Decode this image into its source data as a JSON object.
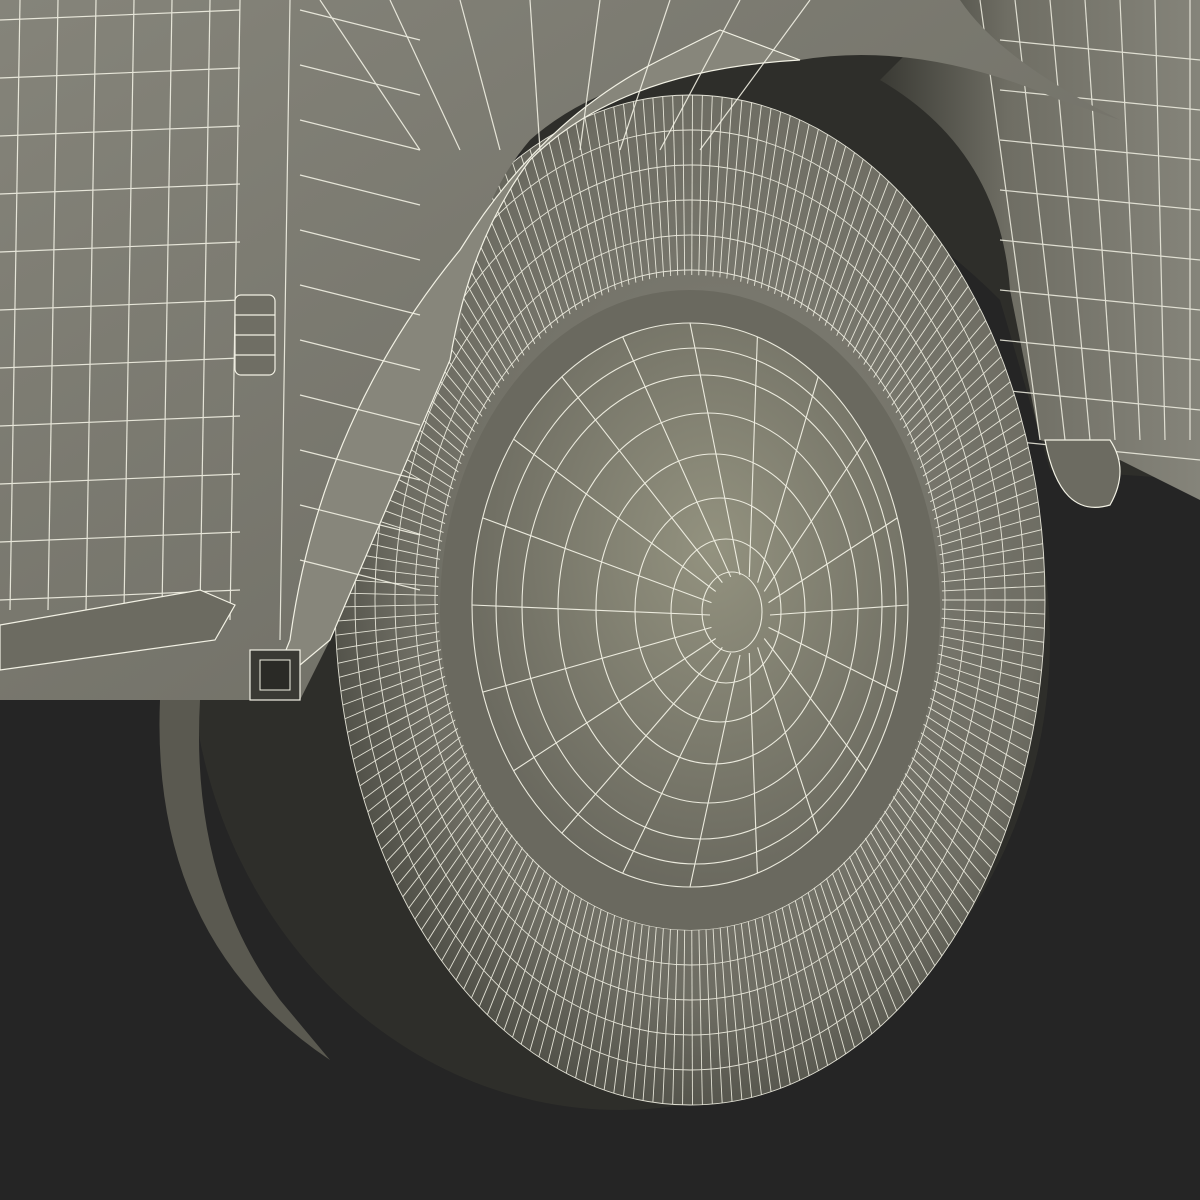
{
  "scene": {
    "colors": {
      "background": "#252525",
      "body_panel": "#7f7e71",
      "body_panel_dark": "#5f5e53",
      "tire": "#75746a",
      "tire_shadow": "#4a4a42",
      "hub": "#8a897c",
      "wire": "#f2f1e4"
    }
  }
}
